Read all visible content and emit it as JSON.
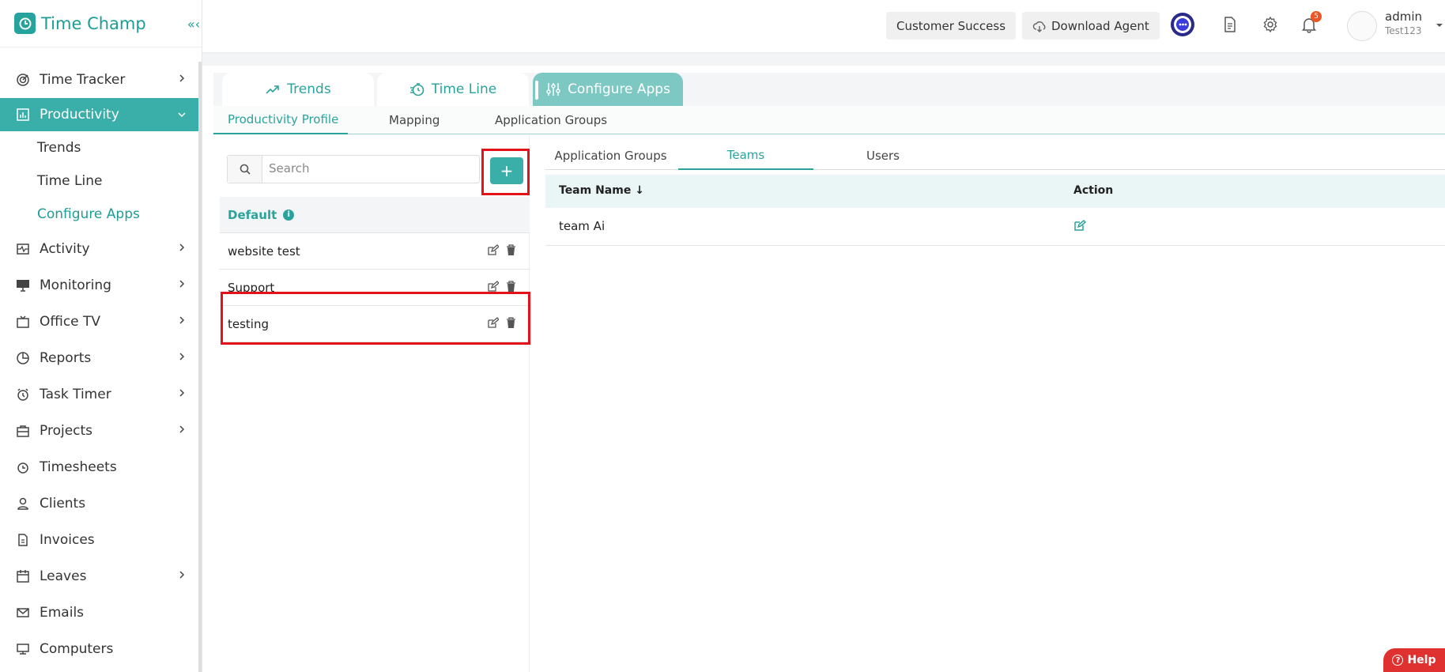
{
  "app": {
    "title": "Time Champ"
  },
  "sidebar": {
    "items": [
      {
        "label": "Time Tracker",
        "icon": "target-icon",
        "chevron": true
      },
      {
        "label": "Productivity",
        "icon": "bar-chart-icon",
        "active": true,
        "expanded": true
      },
      {
        "label": "Activity",
        "icon": "activity-icon",
        "chevron": true
      },
      {
        "label": "Monitoring",
        "icon": "monitor-icon",
        "chevron": true
      },
      {
        "label": "Office TV",
        "icon": "tv-icon",
        "chevron": true
      },
      {
        "label": "Reports",
        "icon": "pie-chart-icon",
        "chevron": true
      },
      {
        "label": "Task Timer",
        "icon": "alarm-icon",
        "chevron": true
      },
      {
        "label": "Projects",
        "icon": "briefcase-icon",
        "chevron": true
      },
      {
        "label": "Timesheets",
        "icon": "clock-icon",
        "chevron": false
      },
      {
        "label": "Clients",
        "icon": "user-icon",
        "chevron": false
      },
      {
        "label": "Invoices",
        "icon": "invoice-icon",
        "chevron": false
      },
      {
        "label": "Leaves",
        "icon": "calendar-icon",
        "chevron": true
      },
      {
        "label": "Emails",
        "icon": "mail-icon",
        "chevron": false
      },
      {
        "label": "Computers",
        "icon": "computer-icon",
        "chevron": false
      }
    ],
    "productivity_sub": [
      "Trends",
      "Time Line",
      "Configure Apps"
    ]
  },
  "header": {
    "customer_success": "Customer Success",
    "download_agent": "Download Agent",
    "notification_count": "5",
    "user_name": "admin",
    "user_org": "Test123"
  },
  "top_tabs": [
    "Trends",
    "Time Line",
    "Configure Apps"
  ],
  "sub_tabs": [
    "Productivity Profile",
    "Mapping",
    "Application Groups"
  ],
  "left_panel": {
    "search_placeholder": "Search",
    "add_label": "+",
    "default_label": "Default",
    "profiles": [
      "website test",
      "Support",
      "testing"
    ]
  },
  "right_panel": {
    "tabs": [
      "Application Groups",
      "Teams",
      "Users"
    ],
    "columns": [
      "Team Name",
      "Action"
    ],
    "rows": [
      {
        "team": "team Ai"
      }
    ]
  },
  "help": {
    "label": "Help"
  },
  "colors": {
    "accent": "#3aafa9",
    "highlight": "#e3121a"
  }
}
